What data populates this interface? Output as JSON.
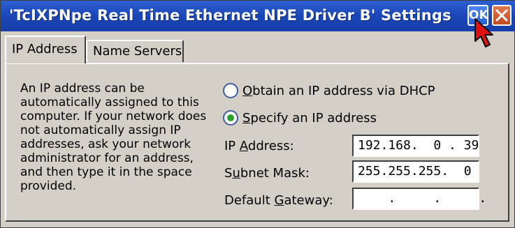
{
  "window": {
    "title": "'TcIXPNpe Real Time Ethernet NPE Driver B' Settings",
    "ok_label": "OK"
  },
  "tabs": [
    {
      "label": "IP Address"
    },
    {
      "label": "Name Servers"
    }
  ],
  "description": "An IP address can be automatically assigned to this computer.  If your network does not automatically assign IP addresses, ask your network administrator for an address, and then type it in the space provided.",
  "options": {
    "dhcp": {
      "mnemonic": "O",
      "rest": "btain an IP address via DHCP",
      "selected": false
    },
    "specify": {
      "mnemonic": "S",
      "rest": "pecify an IP address",
      "selected": true
    }
  },
  "fields": {
    "ip_address": {
      "label_pre": "IP ",
      "mnemonic": "A",
      "label_post": "ddress:",
      "value": "192.168.  0 . 39"
    },
    "subnet_mask": {
      "label_pre": "S",
      "mnemonic": "u",
      "label_post": "bnet Mask:",
      "value": "255.255.255.  0"
    },
    "default_gateway": {
      "label_pre": "Default ",
      "mnemonic": "G",
      "label_post": "ateway:",
      "value": "    .     .     ."
    }
  }
}
